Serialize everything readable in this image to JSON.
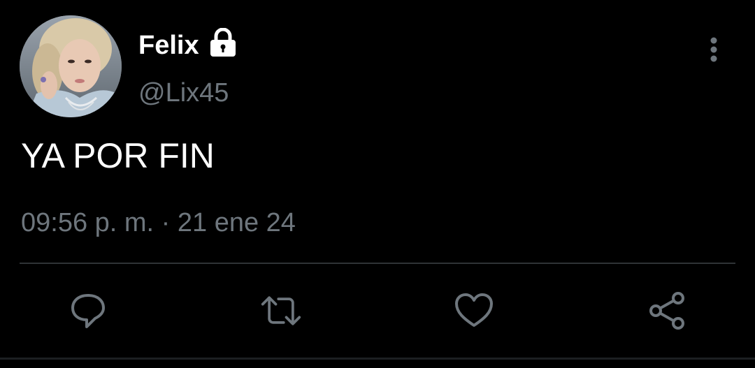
{
  "tweet": {
    "author": {
      "name": "Felix",
      "handle": "@Lix45",
      "protected_icon": "lock-icon"
    },
    "text": "YA POR FIN",
    "timestamp": "09:56 p. m. · 21 ene 24"
  },
  "actions": [
    {
      "name": "reply",
      "icon": "comment-icon"
    },
    {
      "name": "retweet",
      "icon": "retweet-icon"
    },
    {
      "name": "like",
      "icon": "heart-icon"
    },
    {
      "name": "share",
      "icon": "share-icon"
    }
  ],
  "menu_icon": "more-vertical-icon",
  "colors": {
    "background": "#000000",
    "primary_text": "#ffffff",
    "secondary_text": "#6e767d",
    "divider": "#2f3336"
  }
}
